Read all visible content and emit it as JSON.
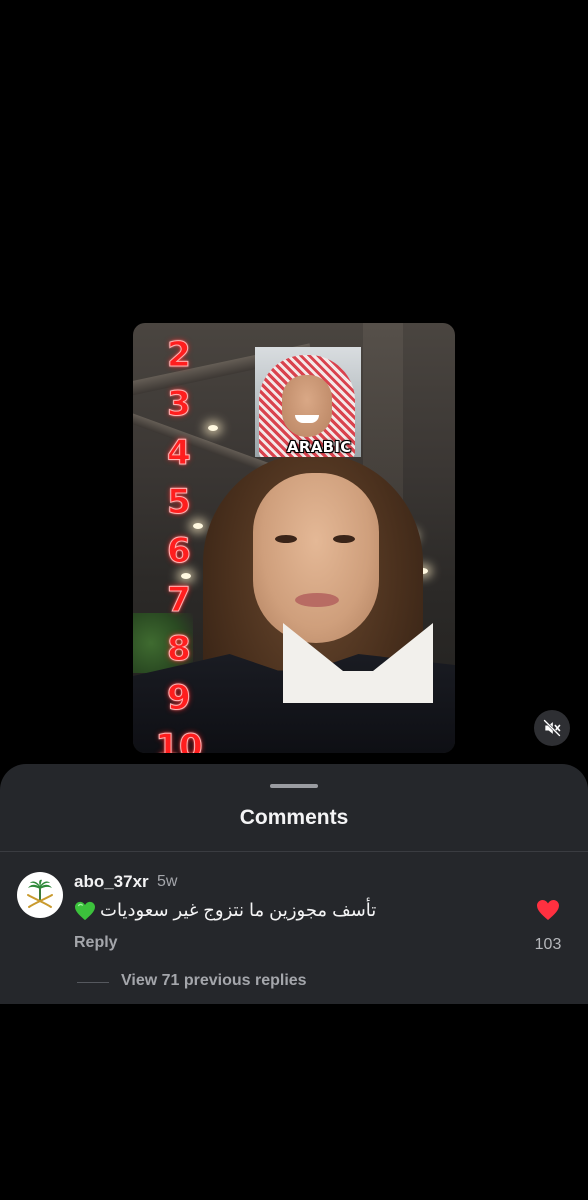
{
  "video": {
    "sticker_label": "ARABIC",
    "numbers": [
      "2",
      "3",
      "4",
      "5",
      "6",
      "7",
      "8",
      "9",
      "10"
    ]
  },
  "controls": {
    "mute_icon": "speaker-muted-icon"
  },
  "comments_sheet": {
    "title": "Comments",
    "comment": {
      "username": "abo_37xr",
      "time": "5w",
      "text": "تأسف مجوزين ما نتزوج غير سعوديات",
      "emoji": "green-heart-icon",
      "reply_label": "Reply",
      "likes": "103",
      "like_color": "#ff3040"
    },
    "view_replies_label": "View 71 previous replies"
  }
}
